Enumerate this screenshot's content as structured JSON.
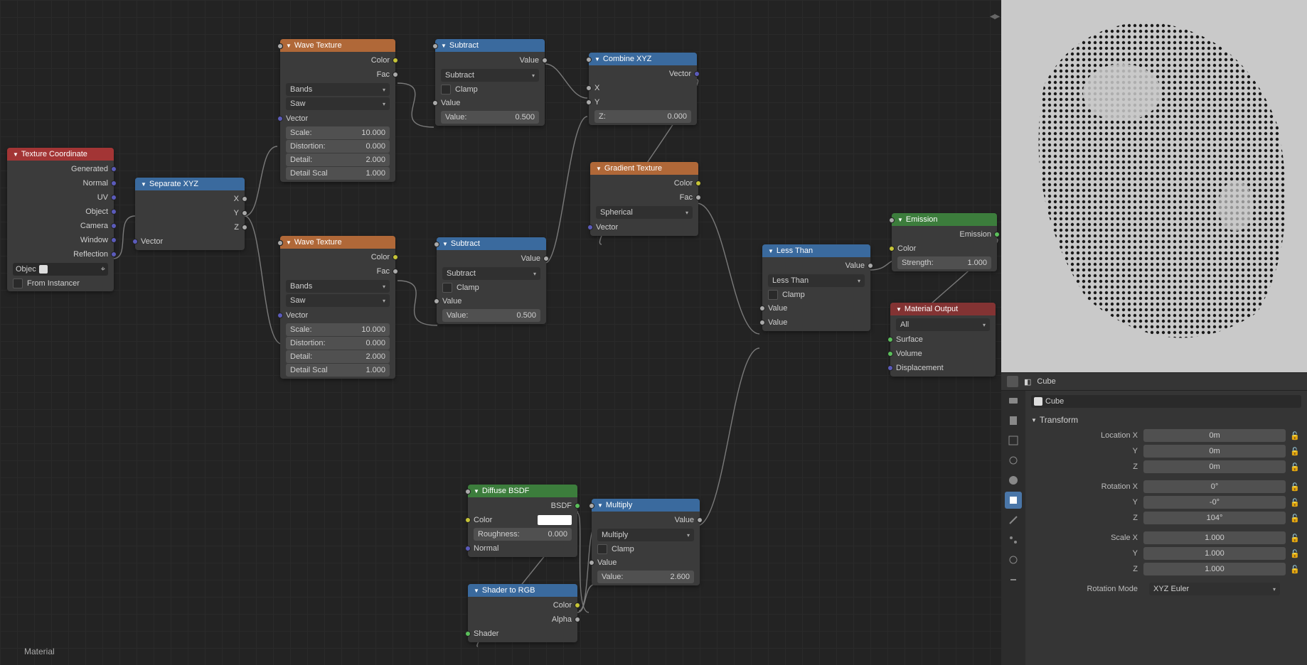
{
  "editor": {
    "bottom_label": "Material"
  },
  "nodes": {
    "texcoord": {
      "title": "Texture Coordinate",
      "outs": [
        "Generated",
        "Normal",
        "UV",
        "Object",
        "Camera",
        "Window",
        "Reflection"
      ],
      "object_label": "Objec",
      "from_instancer": "From Instancer"
    },
    "sepxyz": {
      "title": "Separate XYZ",
      "outs": [
        "X",
        "Y",
        "Z"
      ],
      "in": "Vector"
    },
    "wave1": {
      "title": "Wave Texture",
      "outs": [
        "Color",
        "Fac"
      ],
      "dd1": "Bands",
      "dd2": "Saw",
      "vector": "Vector",
      "scale_l": "Scale:",
      "scale_v": "10.000",
      "dist_l": "Distortion:",
      "dist_v": "0.000",
      "detail_l": "Detail:",
      "detail_v": "2.000",
      "dscale_l": "Detail Scal",
      "dscale_v": "1.000"
    },
    "wave2": {
      "title": "Wave Texture",
      "outs": [
        "Color",
        "Fac"
      ],
      "dd1": "Bands",
      "dd2": "Saw",
      "vector": "Vector",
      "scale_l": "Scale:",
      "scale_v": "10.000",
      "dist_l": "Distortion:",
      "dist_v": "0.000",
      "detail_l": "Detail:",
      "detail_v": "2.000",
      "dscale_l": "Detail Scal",
      "dscale_v": "1.000"
    },
    "sub1": {
      "title": "Subtract",
      "out": "Value",
      "op": "Subtract",
      "clamp": "Clamp",
      "val_lbl": "Value",
      "val2_l": "Value:",
      "val2_v": "0.500"
    },
    "sub2": {
      "title": "Subtract",
      "out": "Value",
      "op": "Subtract",
      "clamp": "Clamp",
      "val_lbl": "Value",
      "val2_l": "Value:",
      "val2_v": "0.500"
    },
    "combine": {
      "title": "Combine XYZ",
      "out": "Vector",
      "x": "X",
      "y": "Y",
      "z_l": "Z:",
      "z_v": "0.000"
    },
    "gradient": {
      "title": "Gradient Texture",
      "outs": [
        "Color",
        "Fac"
      ],
      "type": "Spherical",
      "in": "Vector"
    },
    "emission": {
      "title": "Emission",
      "out": "Emission",
      "color": "Color",
      "str_l": "Strength:",
      "str_v": "1.000"
    },
    "less": {
      "title": "Less Than",
      "out": "Value",
      "op": "Less Than",
      "clamp": "Clamp",
      "v1": "Value",
      "v2": "Value"
    },
    "matout": {
      "title": "Material Output",
      "target": "All",
      "surface": "Surface",
      "volume": "Volume",
      "disp": "Displacement"
    },
    "diffuse": {
      "title": "Diffuse BSDF",
      "out": "BSDF",
      "color": "Color",
      "rough_l": "Roughness:",
      "rough_v": "0.000",
      "normal": "Normal"
    },
    "shadergb": {
      "title": "Shader to RGB",
      "outs": [
        "Color",
        "Alpha"
      ],
      "in": "Shader"
    },
    "mult": {
      "title": "Multiply",
      "out": "Value",
      "op": "Multiply",
      "clamp": "Clamp",
      "val_lbl": "Value",
      "val2_l": "Value:",
      "val2_v": "2.600"
    }
  },
  "props": {
    "object_name": "Cube",
    "datablock_name": "Cube",
    "transform_label": "Transform",
    "loc_x_l": "Location X",
    "loc_x_v": "0m",
    "loc_y_l": "Y",
    "loc_y_v": "0m",
    "loc_z_l": "Z",
    "loc_z_v": "0m",
    "rot_x_l": "Rotation X",
    "rot_x_v": "0°",
    "rot_y_l": "Y",
    "rot_y_v": "-0°",
    "rot_z_l": "Z",
    "rot_z_v": "104°",
    "scale_x_l": "Scale X",
    "scale_x_v": "1.000",
    "scale_y_l": "Y",
    "scale_y_v": "1.000",
    "scale_z_l": "Z",
    "scale_z_v": "1.000",
    "rotmode_l": "Rotation Mode",
    "rotmode_v": "XYZ Euler"
  }
}
